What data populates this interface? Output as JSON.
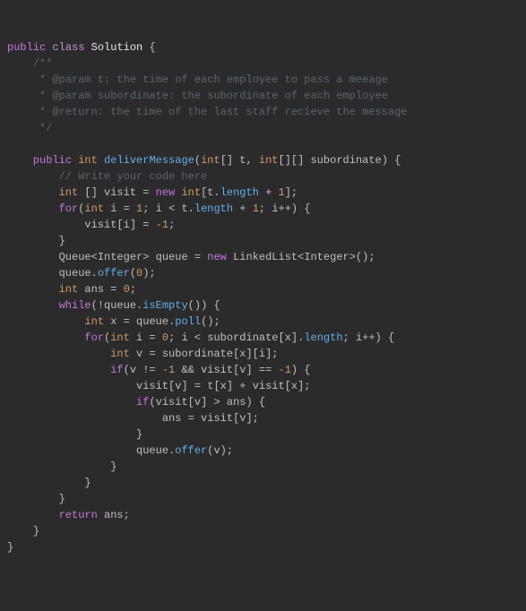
{
  "code": {
    "kw": {
      "public": "public",
      "class": "class",
      "int": "int",
      "new": "new",
      "for": "for",
      "while": "while",
      "if": "if",
      "return": "return"
    },
    "cls": {
      "Solution": "Solution",
      "Integer": "Integer",
      "Queue": "Queue",
      "LinkedList": "LinkedList"
    },
    "method": {
      "deliverMessage": "deliverMessage",
      "length": "length",
      "offer": "offer",
      "isEmpty": "isEmpty",
      "poll": "poll"
    },
    "id": {
      "t": "t",
      "subordinate": "subordinate",
      "visit": "visit",
      "i": "i",
      "queue": "queue",
      "ans": "ans",
      "x": "x",
      "v": "v"
    },
    "num": {
      "zero": "0",
      "one": "1",
      "negone": "-1"
    },
    "comment": {
      "blockOpen": "/**",
      "l1": " * @param t: the time of each employee to pass a meeage",
      "l2": " * @param subordinate: the subordinate of each employee",
      "l3": " * @return: the time of the last staff recieve the message",
      "blockClose": " */",
      "line": "// Write your code here"
    }
  }
}
